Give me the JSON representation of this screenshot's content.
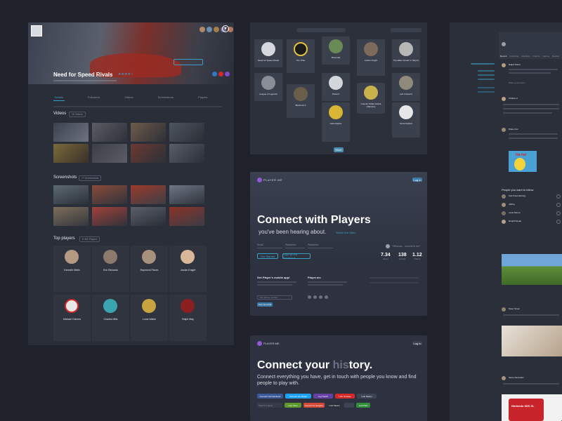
{
  "game": {
    "title": "Need for Speed Rivals",
    "tabs": [
      "Details",
      "Followers",
      "Videos",
      "Screenshots",
      "Players"
    ],
    "videos_label": "Videos",
    "videos_count": "16 Videos",
    "screenshots_label": "Screenshots",
    "screenshots_count": "77 Screenshots",
    "top_players_label": "Top players",
    "top_players_count": "8 462 Players",
    "players": [
      "Kenneth Wells",
      "Eric Richards",
      "Raymond Flores",
      "Jordan Knight",
      "Michael Holmes",
      "Charles Mills",
      "Louis Walsh",
      "Ralph May"
    ]
  },
  "grid": {
    "games": [
      "Need for Speed Rivals",
      "The Tribe",
      "Minecraft",
      "Amber Knight",
      "The Elder Scrolls V: Skyrim",
      "League of Legends",
      "Bioshock 4",
      "Portal 2",
      "Counter Strike Global Offensive",
      "Left 4 Dead 2",
      "GameSpace",
      "Hummingbird"
    ],
    "more_button": "More"
  },
  "landing1": {
    "brand": "PLAYER.ME",
    "login": "Log in",
    "headline": "Connect with Players",
    "subline": "you've been hearing about.",
    "watch": "Watch the video",
    "email_ph": "Email",
    "pass_ph": "Password",
    "confirm_ph": "Password",
    "signup_btn": "Get Started",
    "fb_btn": "Sign up via Facebook",
    "quote": "\"Whoooa... smooth is fun\"",
    "stats": [
      {
        "num": "7.34",
        "label": "Users"
      },
      {
        "num": "138",
        "label": "Games"
      },
      {
        "num": "1.12",
        "label": "Videos"
      }
    ],
    "mobile_title": "Get Player's mobile app!",
    "mobile_ph": "Your phone number",
    "mobile_btn": "Text me a link",
    "about_title": "Player.me"
  },
  "landing2": {
    "brand": "PLAYER.ME",
    "login": "Log in",
    "headline_a": "Connect your",
    "headline_b": "his",
    "headline_c": "tory.",
    "body": "Connect everything you have, get in touch with people you know and find people to play with.",
    "connect_buttons": [
      "Connect via Facebook",
      "Connect via Twitter",
      "Log Twitch",
      "Link Youtube",
      "Link Steam"
    ],
    "connect_buttons_2": [
      "Live Xbox",
      "Connect to Google+",
      "Link Steam",
      "Link PSN"
    ],
    "search_ph": "Search a game"
  },
  "feed": {
    "tabs": [
      "Recent",
      "Following",
      "Mentions",
      "Friends",
      "Games",
      "Replies",
      "Followers"
    ],
    "suggest_title": "People you want to follow",
    "comment_ph": "Write a comment...",
    "names": [
      "Ralph Fisher",
      "Charlie H.",
      "Diane Fox",
      "Karl Freemanborg",
      "Jeffrey",
      "Louis Moore",
      "Rudolf Novak",
      "Peter Tonen",
      "Steve Alexander"
    ],
    "fb_title": "Nintendo 3DS XL",
    "meme_text": "Ha-ha!"
  },
  "colors": {
    "bg": "#1f222b",
    "card": "#2a2e39",
    "accent": "#3d9ec5",
    "purple": "#8f5bd4"
  }
}
